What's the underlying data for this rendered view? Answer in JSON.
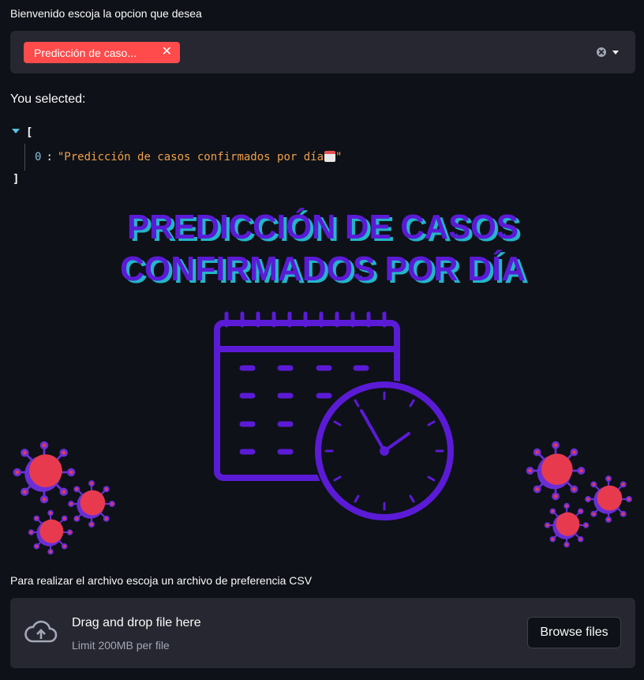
{
  "select_label": "Bienvenido escoja la opcion que desea",
  "multiselect": {
    "tag_label": "Predicción de caso...",
    "tag_remove_icon": "✕",
    "clear_icon": "clear-icon",
    "dropdown_icon": "chevron-down-icon"
  },
  "selected_label": "You selected:",
  "json_view": {
    "open_bracket": "[",
    "close_bracket": "]",
    "items": [
      {
        "index": "0",
        "value": "\"Predicción de casos confirmados por día",
        "suffix": "\""
      }
    ]
  },
  "banner": {
    "title_line1": "PREDICCIÓN DE CASOS",
    "title_line2": "CONFIRMADOS POR DÍA",
    "colors": {
      "primary": "#5b1bd6",
      "accent": "#e83a4f",
      "title_shadow": "#23b5c9"
    }
  },
  "upload": {
    "label": "Para realizar el archivo escoja un archivo de preferencia CSV",
    "drop_title": "Drag and drop file here",
    "limit": "Limit 200MB per file",
    "browse_label": "Browse files"
  }
}
